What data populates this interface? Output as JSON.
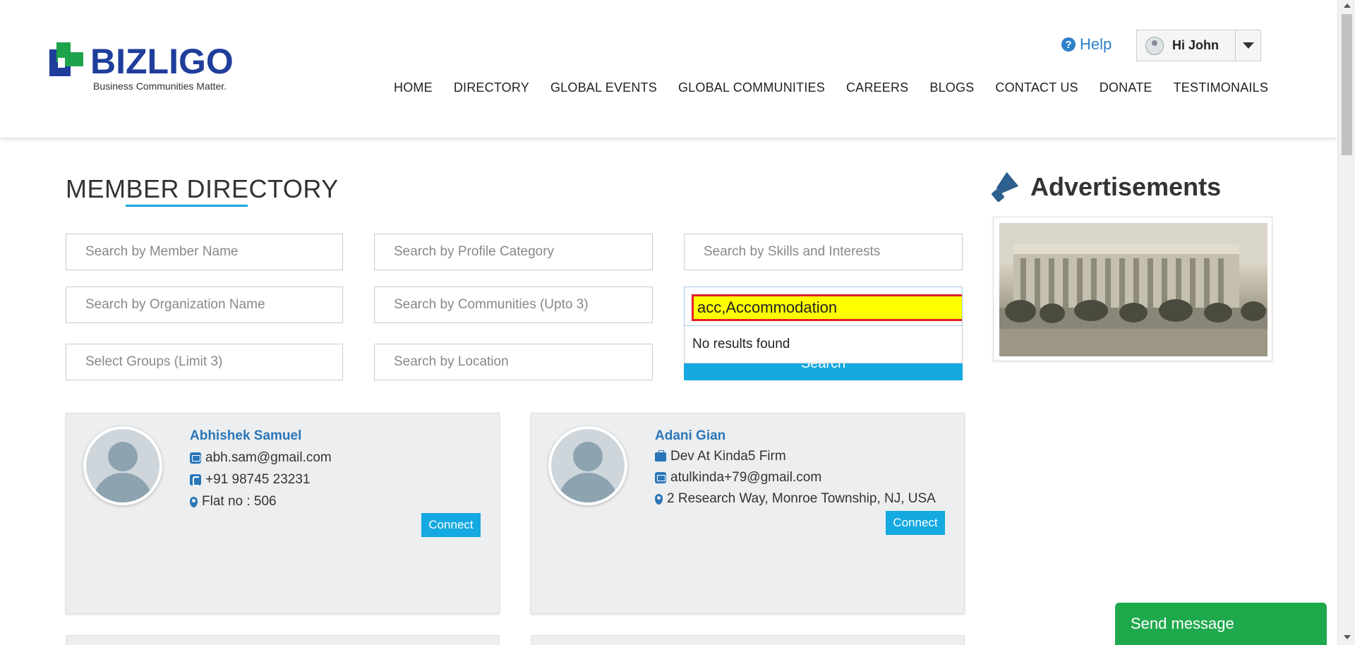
{
  "header": {
    "logo_text": "BIZLIGO",
    "logo_tagline": "Business Communities Matter.",
    "help_label": "Help",
    "user_greeting": "Hi John",
    "nav": [
      "HOME",
      "DIRECTORY",
      "GLOBAL EVENTS",
      "GLOBAL COMMUNITIES",
      "CAREERS",
      "BLOGS",
      "CONTACT US",
      "DONATE",
      "TESTIMONAILS"
    ]
  },
  "directory": {
    "title": "MEMBER DIRECTORY",
    "placeholders": {
      "member_name": "Search by Member Name",
      "profile_category": "Search by Profile Category",
      "skills_interests": "Search by Skills and Interests",
      "organization": "Search by Organization Name",
      "communities": "Search by Communities (Upto 3)",
      "groups": "Select Groups (Limit 3)",
      "location": "Search by Location"
    },
    "skills_value": "acc,Accommodation",
    "no_results": "No results found",
    "search_button": "Search"
  },
  "advertisements": {
    "title": "Advertisements"
  },
  "members": [
    {
      "name": "Abhishek Samuel",
      "email": "abh.sam@gmail.com",
      "phone": "+91 98745 23231",
      "address": "Flat no : 506",
      "connect": "Connect"
    },
    {
      "name": "Adani Gian",
      "job": "Dev At Kinda5 Firm",
      "email": "atulkinda+79@gmail.com",
      "address": "2 Research Way, Monroe Township, NJ, USA",
      "connect": "Connect"
    }
  ],
  "chat": {
    "send_message": "Send message"
  },
  "colors": {
    "brand_blue": "#1f3e9c",
    "brand_green": "#1fa34a",
    "accent": "#14a9e1",
    "link": "#2a76b8",
    "highlight_yellow": "#ffff00",
    "highlight_border": "#e0202c",
    "chat_green": "#1fa94d"
  },
  "icons": [
    "help-icon",
    "user-avatar-icon",
    "caret-down-icon",
    "megaphone-icon",
    "envelope-icon",
    "phone-icon",
    "briefcase-icon",
    "map-marker-icon",
    "search-icon"
  ]
}
